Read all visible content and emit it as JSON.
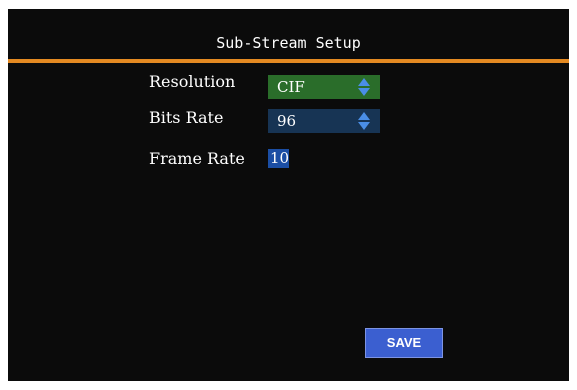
{
  "dialog": {
    "title": "Sub-Stream Setup"
  },
  "settings": {
    "resolution": {
      "label": "Resolution",
      "value": "CIF",
      "highlight_color": "#2a6d2a"
    },
    "bits_rate": {
      "label": "Bits Rate",
      "value": "96",
      "field_color": "#173454"
    },
    "frame_rate": {
      "label": "Frame Rate",
      "value": "10",
      "field_color": "#1b4ea4"
    }
  },
  "actions": {
    "save_label": "SAVE"
  },
  "colors": {
    "background": "#0b0b0b",
    "accent_rule": "#e48a22",
    "spinner": "#4a8ee6",
    "save_button": "#3b5fd0"
  },
  "icons": {
    "spinner": "up-down-spinner-icon"
  }
}
